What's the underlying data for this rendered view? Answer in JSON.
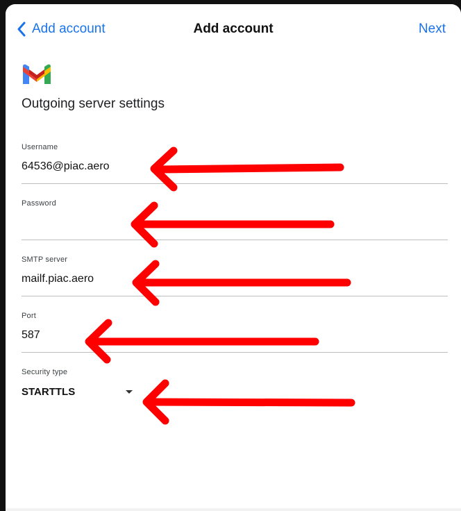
{
  "nav": {
    "back_label": "Add account",
    "title": "Add account",
    "next_label": "Next"
  },
  "section_title": "Outgoing server settings",
  "fields": {
    "username": {
      "label": "Username",
      "value": "64536@piac.aero"
    },
    "password": {
      "label": "Password",
      "value": ""
    },
    "smtp": {
      "label": "SMTP server",
      "value": "mailf.piac.aero"
    },
    "port": {
      "label": "Port",
      "value": "587"
    },
    "security": {
      "label": "Security type",
      "value": "STARTTLS"
    }
  },
  "colors": {
    "accent": "#1a73e8",
    "annotation_arrow": "#ff0000"
  },
  "icons": [
    "chevron-left-icon",
    "gmail-logo",
    "caret-down-icon",
    "red-arrow-annotation"
  ]
}
